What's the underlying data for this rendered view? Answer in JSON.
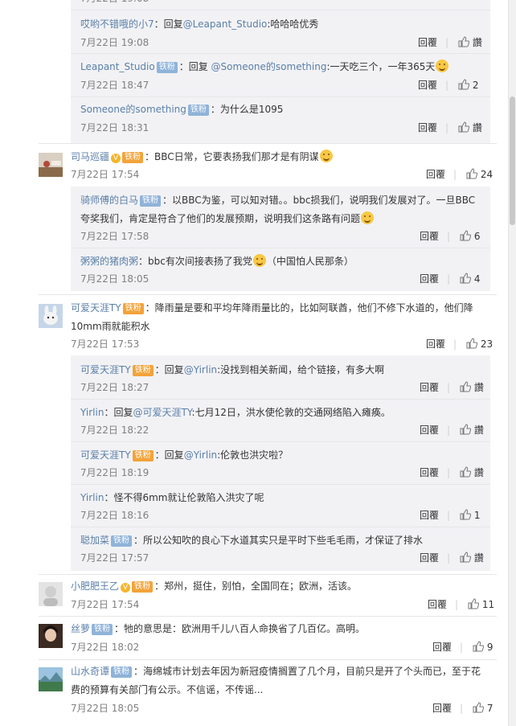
{
  "colors": {
    "username": "#5a7fa8",
    "text": "#333333",
    "time": "#808080",
    "reply_bg": "#f2f2f5",
    "badge": "#8fb3d9",
    "badge_gold": "#f3a33a"
  },
  "labels": {
    "reply": "回覆",
    "like": "讚",
    "reply_to": "回复"
  },
  "badges": {
    "fan": "铁粉",
    "gold_fan": "铁粉"
  },
  "comments": [
    {
      "user": "哎哟不错哦的小7",
      "text": "：回复@Leapant_Studio:哈哈哈优秀",
      "time": "7月22日 19:08",
      "likes": "讚"
    },
    {
      "user": "Leapant_Studio",
      "text_pre": "：回复 ",
      "mention": "@Someone的something",
      "text": ":一天吃三个，一年365天",
      "time": "7月22日 18:47",
      "likes": "2"
    },
    {
      "user": "Someone的something",
      "text": "：为什么是1095",
      "time": "7月22日 18:31",
      "likes": "讚"
    },
    {
      "user": "司马巡疆",
      "text": "：BBC日常，它要表扬我们那才是有阴谋",
      "time": "7月22日 17:54",
      "likes": "24"
    },
    {
      "user": "骑师傅的白马",
      "text": "：以BBC为鉴，可以知对错。。bbc损我们，说明我们发展对了。一旦BBC",
      "text2": "夸奖我们，肯定是符合了他们的发展预期，说明我们这条路有问题",
      "time": "7月22日 17:58",
      "likes": "6"
    },
    {
      "user": "粥粥的猪肉粥",
      "text": "：bbc有次间接表扬了我党",
      "text_post": "（中国怕人民那条）",
      "time": "7月22日 18:05",
      "likes": "4"
    },
    {
      "user": "可爱天涯TY",
      "text": "：降雨量是要和平均年降雨量比的，比如阿联酋，他们不修下水道的，他们降",
      "text2": "10mm雨就能积水",
      "time": "7月22日 17:53",
      "likes": "23"
    },
    {
      "user": "可爱天涯TY",
      "text_pre": "：回复",
      "mention": "@Yirlin",
      "text": ":没找到相关新闻，给个链接，有多大啊",
      "time": "7月22日 18:27",
      "likes": "讚"
    },
    {
      "user": "Yirlin",
      "text_pre": "：回复",
      "mention": "@可爱天涯TY",
      "text": ":七月12日，洪水使伦敦的交通网络陷入瘫痪。",
      "time": "7月22日 18:22",
      "likes": "讚"
    },
    {
      "user": "可爱天涯TY",
      "text_pre": "：回复",
      "mention": "@Yirlin",
      "text": ":伦敦也洪灾啦？",
      "time": "7月22日 18:19",
      "likes": "讚"
    },
    {
      "user": "Yirlin",
      "text": "：怪不得6mm就让伦敦陷入洪灾了呢",
      "time": "7月22日 18:16",
      "likes": "1"
    },
    {
      "user": "聪加菜",
      "text": "：所以公知吹的良心下水道其实只是平时下些毛毛雨，才保证了排水",
      "time": "7月22日 17:57",
      "likes": "讚"
    },
    {
      "user": "小肥肥王乙",
      "text": "：郑州，挺住，别怕，全国同在；欧洲，活该。",
      "time": "7月22日 17:54",
      "likes": "11"
    },
    {
      "user": "丝萝",
      "text": "：牠的意思是：欧洲用千儿八百人命换省了几百亿。高明。",
      "time": "7月22日 18:02",
      "likes": "9"
    },
    {
      "user": "山水奇谭",
      "text": "：海绵城市计划去年因为新冠疫情搁置了几个月，目前只是开了个头而已，至于花",
      "text2": "费的预算有关部门有公示。不信谣，不传谣...",
      "time": "7月22日 18:05",
      "likes": "7"
    }
  ]
}
